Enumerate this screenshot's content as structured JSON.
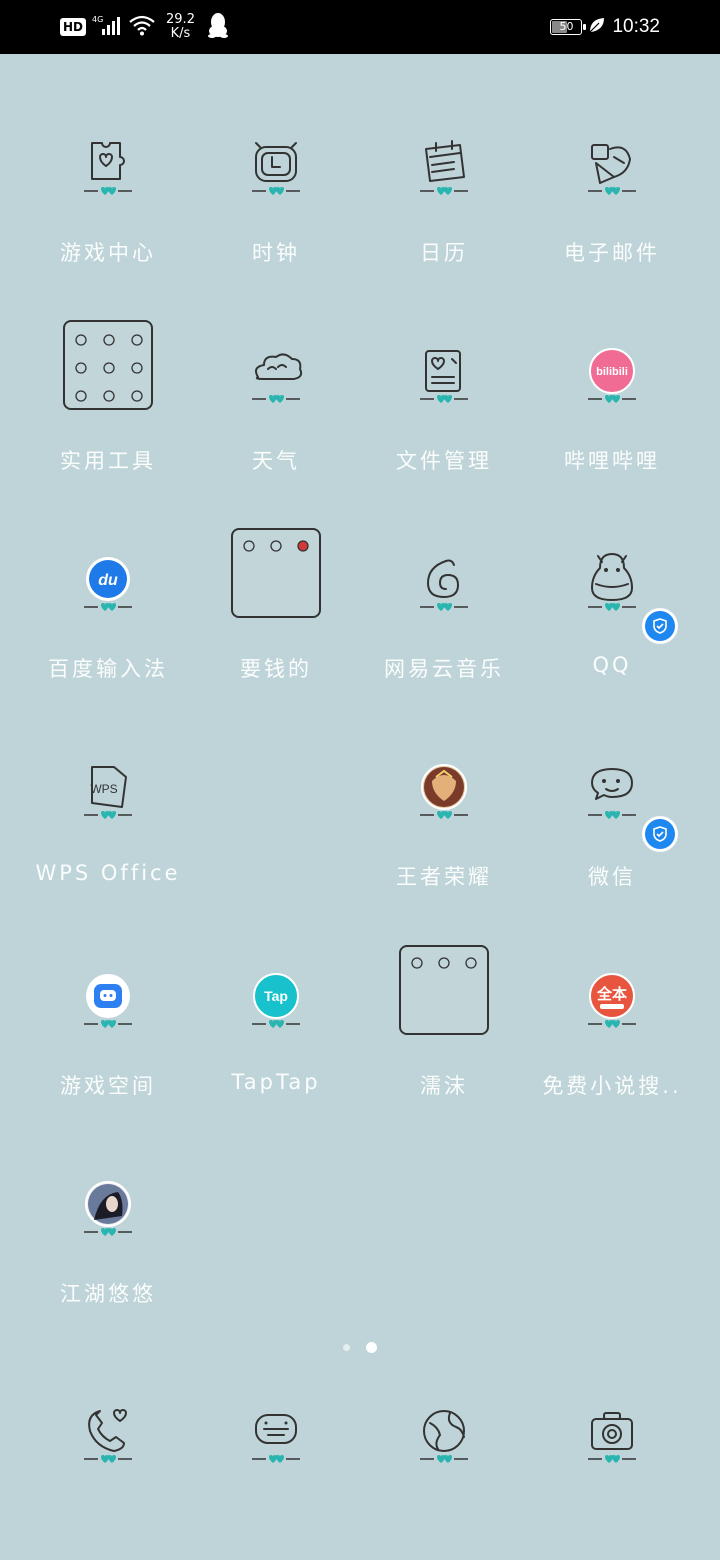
{
  "status_bar": {
    "hd": "HD",
    "network": "4G",
    "speed_value": "29.2",
    "speed_unit": "K/s",
    "battery": "50",
    "time": "10:32"
  },
  "rows": [
    [
      {
        "label": "游戏中心",
        "icon": "puzzle-heart-icon"
      },
      {
        "label": "时钟",
        "icon": "alarm-clock-icon"
      },
      {
        "label": "日历",
        "icon": "calendar-icon"
      },
      {
        "label": "电子邮件",
        "icon": "mail-icon"
      }
    ],
    [
      {
        "label": "实用工具",
        "icon": "folder-icon"
      },
      {
        "label": "天气",
        "icon": "cloud-icon"
      },
      {
        "label": "文件管理",
        "icon": "file-icon"
      },
      {
        "label": "哔哩哔哩",
        "icon": "bilibili-icon"
      }
    ],
    [
      {
        "label": "百度输入法",
        "icon": "baidu-ime-icon"
      },
      {
        "label": "要钱的",
        "icon": "folder-icon"
      },
      {
        "label": "网易云音乐",
        "icon": "music-icon"
      },
      {
        "label": "QQ",
        "icon": "qq-penguin-icon"
      }
    ],
    [
      {
        "label": "WPS Office",
        "icon": "wps-icon"
      },
      {
        "label": "",
        "icon": ""
      },
      {
        "label": "王者荣耀",
        "icon": "honor-of-kings-icon"
      },
      {
        "label": "微信",
        "icon": "wechat-icon"
      }
    ],
    [
      {
        "label": "游戏空间",
        "icon": "game-space-icon"
      },
      {
        "label": "TapTap",
        "icon": "taptap-icon"
      },
      {
        "label": "濡沫",
        "icon": "folder-icon"
      },
      {
        "label": "免费小说搜..",
        "icon": "novel-icon"
      }
    ],
    [
      {
        "label": "江湖悠悠",
        "icon": "jianghu-icon"
      }
    ]
  ],
  "icon_text": {
    "bilibili": "bilibili",
    "baidu": "du",
    "wps": "WPS",
    "taptap": "Tap",
    "novel": "全本"
  },
  "dock": [
    {
      "icon": "phone-heart-icon"
    },
    {
      "icon": "message-icon"
    },
    {
      "icon": "browser-globe-icon"
    },
    {
      "icon": "camera-icon"
    }
  ],
  "colors": {
    "background": "#bfd4d8",
    "label": "#fbfdfd",
    "verified_badge": "#1e87f0",
    "bilibili": "#f06c94",
    "taptap": "#17c2cc",
    "baidu": "#1e7ae8",
    "novel": "#e8553e",
    "hearts": "#2bb5b0"
  }
}
